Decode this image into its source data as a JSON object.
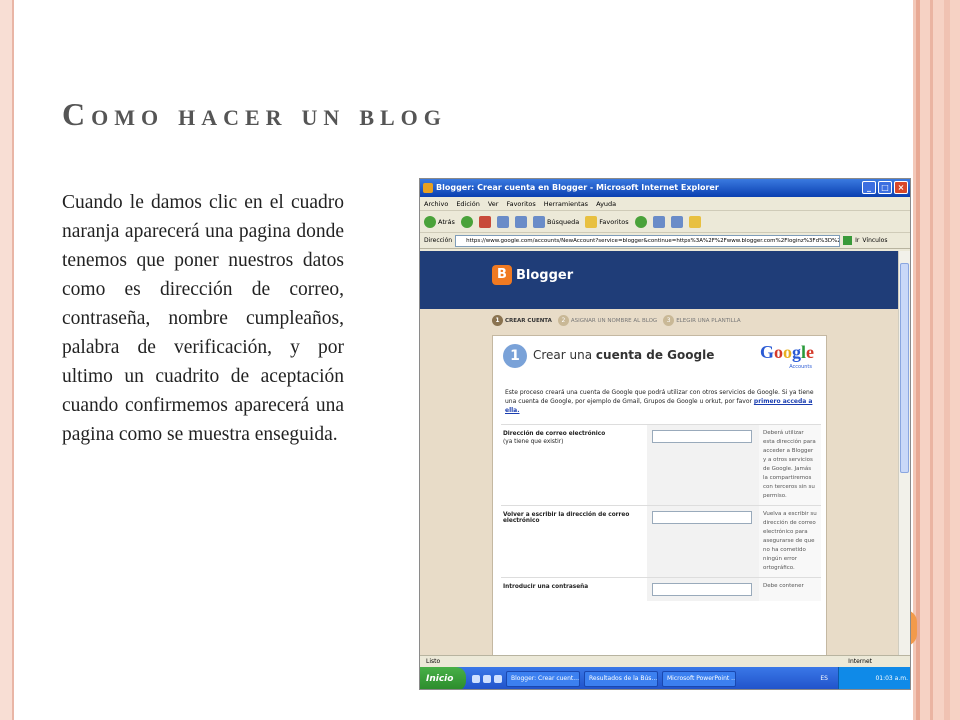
{
  "slide": {
    "title": "Como hacer un blog",
    "body": "Cuando le damos clic en el cuadro naranja aparecerá una pagina donde tenemos que poner nuestros datos como es dirección de correo, contraseña, nombre cumpleaños, palabra de verificación, y por ultimo un cuadrito de aceptación cuando confirmemos aparecerá una pagina como se muestra enseguida."
  },
  "browser": {
    "window_title": "Blogger: Crear cuenta en Blogger - Microsoft Internet Explorer",
    "menu": [
      "Archivo",
      "Edición",
      "Ver",
      "Favoritos",
      "Herramientas",
      "Ayuda"
    ],
    "toolbar": {
      "back": "Atrás",
      "search": "Búsqueda",
      "favorites": "Favoritos"
    },
    "address_label": "Dirección",
    "address_url": "https://www.google.com/accounts/NewAccount?service=blogger&continue=https%3A%2F%2Fwww.blogger.com%2Floginz%3Fd%3D%252Fcreate-blog.g%26a%3",
    "go_label": "Ir",
    "links_label": "Vínculos",
    "status_left": "Listo",
    "status_zone": "Internet"
  },
  "blogger": {
    "logo": "Blogger",
    "steps": [
      {
        "num": "1",
        "label": "CREAR CUENTA"
      },
      {
        "num": "2",
        "label": "ASIGNAR UN NOMBRE AL BLOG"
      },
      {
        "num": "3",
        "label": "ELEGIR UNA PLANTILLA"
      }
    ],
    "card_num": "1",
    "card_title_pre": "Crear una ",
    "card_title_bold": "cuenta de Google",
    "google_accounts": "Accounts",
    "description": "Este proceso creará una cuenta de Google que podrá utilizar con otros servicios de Google. Si ya tiene una cuenta de Google, por ejemplo de Gmail, Grupos de Google u orkut, por favor",
    "description_link": "primero acceda a ella.",
    "rows": [
      {
        "label": "Dirección de correo electrónico",
        "sub": "(ya tiene que existir)",
        "hint": "Deberá utilizar esta dirección para acceder a Blogger y a otros servicios de Google. Jamás la compartiremos con terceros sin su permiso."
      },
      {
        "label": "Volver a escribir la dirección de correo electrónico",
        "sub": "",
        "hint": "Vuelva a escribir su dirección de correo electrónico para asegurarse de que no ha cometido ningún error ortográfico."
      },
      {
        "label": "Introducir una contraseña",
        "sub": "",
        "hint": "Debe contener"
      }
    ]
  },
  "taskbar": {
    "start": "Inicio",
    "tasks": [
      "Blogger: Crear cuent...",
      "Resultados de la Bús...",
      "Microsoft PowerPoint ..."
    ],
    "lang": "ES",
    "clock": "01:03 a.m."
  }
}
